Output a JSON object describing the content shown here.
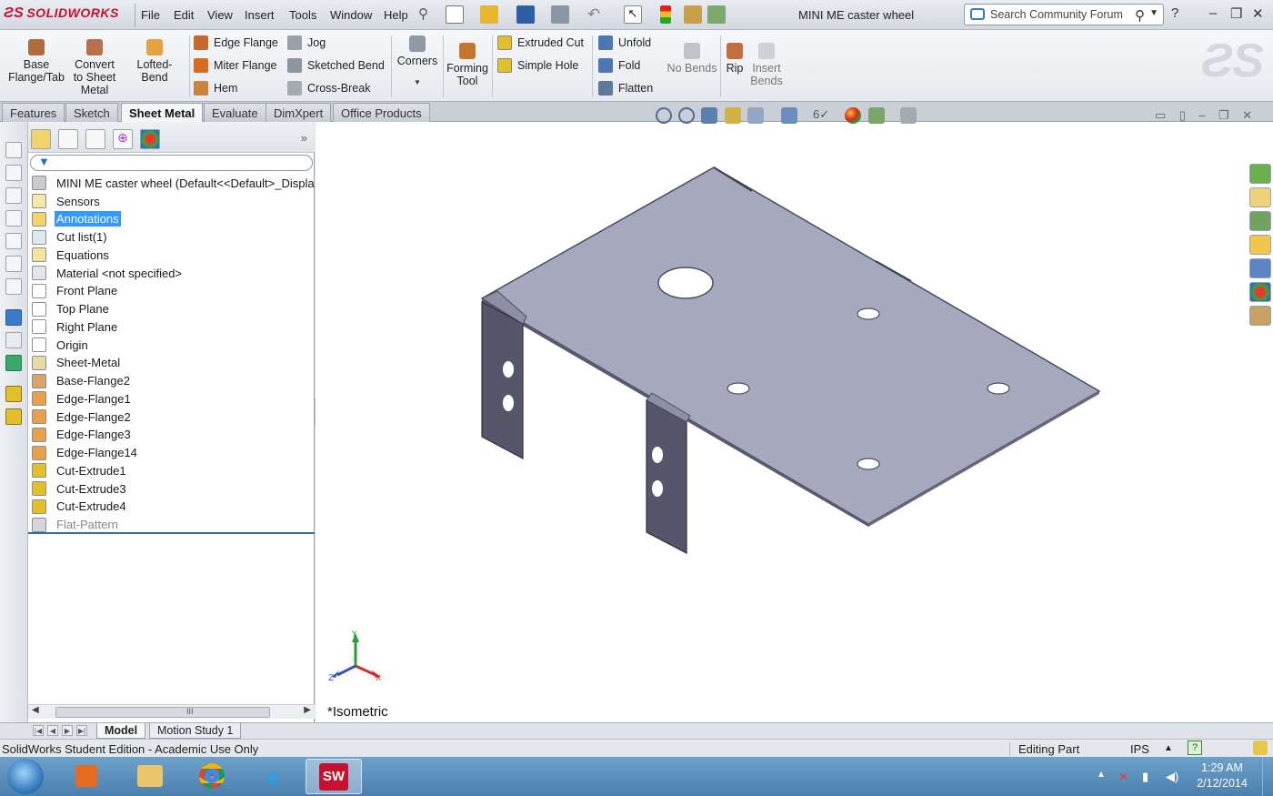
{
  "app": {
    "name": "SOLIDWORKS",
    "doc_title": "MINI ME caster wheel"
  },
  "menu": [
    "File",
    "Edit",
    "View",
    "Insert",
    "Tools",
    "Window",
    "Help"
  ],
  "search": {
    "placeholder": "Search Community Forum"
  },
  "command_manager": {
    "base_flange": "Base\nFlange/Tab",
    "convert": "Convert\nto Sheet\nMetal",
    "lofted_bend": "Lofted-Bend",
    "edge_flange": "Edge Flange",
    "miter_flange": "Miter Flange",
    "hem": "Hem",
    "jog": "Jog",
    "sketched_bend": "Sketched Bend",
    "cross_break": "Cross-Break",
    "corners": "Corners",
    "forming_tool": "Forming\nTool",
    "extruded_cut": "Extruded Cut",
    "simple_hole": "Simple Hole",
    "unfold": "Unfold",
    "fold": "Fold",
    "flatten": "Flatten",
    "no_bends": "No Bends",
    "rip": "Rip",
    "insert_bends": "Insert\nBends"
  },
  "tabs": [
    "Features",
    "Sketch",
    "Sheet Metal",
    "Evaluate",
    "DimXpert",
    "Office Products"
  ],
  "active_tab": "Sheet Metal",
  "feature_tree": {
    "root": "MINI ME caster wheel  (Default<<Default>_Displa",
    "items": [
      {
        "label": "Sensors",
        "icon": "sensor-icon"
      },
      {
        "label": "Annotations",
        "icon": "annotations-icon",
        "selected": true
      },
      {
        "label": "Cut list(1)",
        "icon": "cut-list-icon"
      },
      {
        "label": "Equations",
        "icon": "equations-icon"
      },
      {
        "label": "Material <not specified>",
        "icon": "material-icon"
      },
      {
        "label": "Front Plane",
        "icon": "plane-icon"
      },
      {
        "label": "Top Plane",
        "icon": "plane-icon"
      },
      {
        "label": "Right Plane",
        "icon": "plane-icon"
      },
      {
        "label": "Origin",
        "icon": "origin-icon"
      },
      {
        "label": "Sheet-Metal",
        "icon": "sheet-metal-icon"
      },
      {
        "label": "Base-Flange2",
        "icon": "base-flange-icon"
      },
      {
        "label": "Edge-Flange1",
        "icon": "edge-flange-icon"
      },
      {
        "label": "Edge-Flange2",
        "icon": "edge-flange-icon"
      },
      {
        "label": "Edge-Flange3",
        "icon": "edge-flange-icon"
      },
      {
        "label": "Edge-Flange14",
        "icon": "edge-flange-icon"
      },
      {
        "label": "Cut-Extrude1",
        "icon": "cut-extrude-icon"
      },
      {
        "label": "Cut-Extrude3",
        "icon": "cut-extrude-icon"
      },
      {
        "label": "Cut-Extrude4",
        "icon": "cut-extrude-icon"
      },
      {
        "label": "Flat-Pattern",
        "icon": "flat-pattern-icon",
        "dim": true
      }
    ]
  },
  "viewport": {
    "view_label": "*Isometric",
    "triad": {
      "x": "X",
      "y": "Y",
      "z": "Z"
    }
  },
  "bottom_tabs": [
    "Model",
    "Motion Study 1"
  ],
  "status": {
    "edition": "SolidWorks Student Edition - Academic Use Only",
    "mode": "Editing Part",
    "units": "IPS"
  },
  "taskbar": {
    "time": "1:29 AM",
    "date": "2/12/2014"
  },
  "colors": {
    "brand": "#c8102e",
    "selection": "#3399ff",
    "part_face": "#a6a9bd",
    "part_edge": "#4a4c5e"
  }
}
